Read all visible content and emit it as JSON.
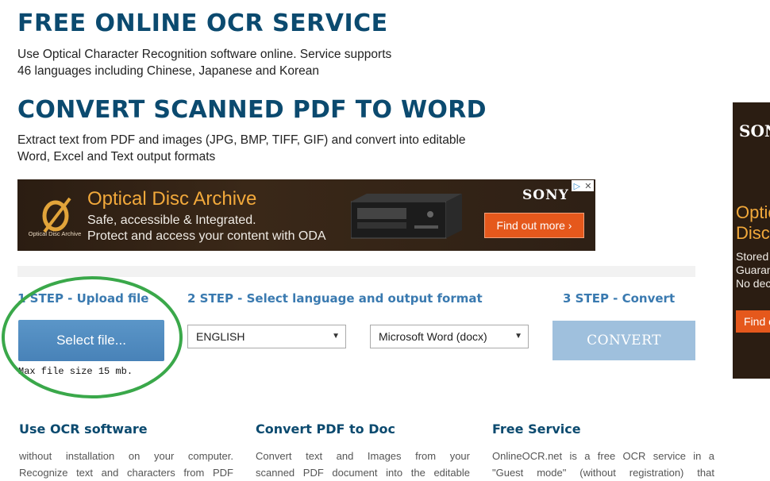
{
  "header": {
    "title": "FREE ONLINE OCR SERVICE",
    "desc_line1": "Use Optical Character Recognition software online. Service supports",
    "desc_line2": "46 languages including Chinese, Japanese and Korean"
  },
  "convert": {
    "title": "CONVERT SCANNED PDF TO WORD",
    "desc_line1": "Extract text from PDF and images (JPG, BMP, TIFF, GIF) and convert into editable",
    "desc_line2": "Word, Excel and Text output formats"
  },
  "banner_ad": {
    "logo_text": "Optical Disc Archive",
    "title": "Optical Disc Archive",
    "line1": "Safe, accessible & Integrated.",
    "line2": "Protect and access your content with ODA",
    "brand": "SONY",
    "cta": "Find out more",
    "cta_arrow": "›",
    "adchoice_icon": "▷",
    "close_icon": "✕"
  },
  "side_ad": {
    "brand": "SONY",
    "title_line1": "Optical",
    "title_line2": "Disc",
    "line1": "Stored",
    "line2": "Guaran",
    "line3": "No dec",
    "cta": "Find o"
  },
  "steps": {
    "step1": "1 STEP - Upload file",
    "step2": "2 STEP - Select language and output format",
    "step3": "3 STEP - Convert",
    "select_file": "Select file...",
    "max_size": "Max file size 15 mb.",
    "language": "ENGLISH",
    "format": "Microsoft Word (docx)",
    "dropdown_arrow": "▼",
    "convert_button": "CONVERT"
  },
  "columns": [
    {
      "title": "Use OCR software",
      "line1": "without installation on your computer.",
      "line2": "Recognize text and characters from PDF"
    },
    {
      "title": "Convert PDF to Doc",
      "line1": "Convert text and Images from your",
      "line2": "scanned PDF document into the editable"
    },
    {
      "title": "Free Service",
      "line1": "OnlineOCR.net is a free OCR service in a",
      "line2": "\"Guest mode\" (without registration) that"
    }
  ],
  "colors": {
    "heading": "#0b4a6f",
    "step": "#3a7ab0",
    "select_button": "#4f8bc0",
    "convert_button": "#9fc0dd",
    "highlight_circle": "#3aa84a",
    "ad_background": "#2b1d12",
    "ad_accent": "#f2a93b",
    "ad_cta": "#e5581c"
  }
}
